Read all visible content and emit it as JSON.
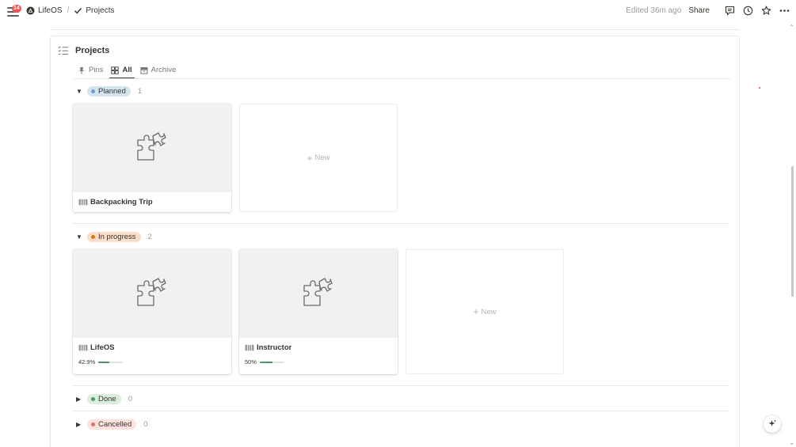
{
  "topbar": {
    "notification_count": "14",
    "breadcrumbs": [
      {
        "label": "LifeOS",
        "icon": "lifeos-logo-icon"
      },
      {
        "label": "Projects",
        "icon": "checkmark-icon"
      }
    ],
    "separator": "/",
    "edited": "Edited 36m ago",
    "share_label": "Share",
    "icons": [
      "comment-icon",
      "clock-icon",
      "star-icon",
      "more-icon"
    ]
  },
  "database": {
    "title": "Projects",
    "tabs": [
      {
        "label": "Pins",
        "icon": "pin-icon",
        "active": false
      },
      {
        "label": "All",
        "icon": "gallery-icon",
        "active": true
      },
      {
        "label": "Archive",
        "icon": "archive-icon",
        "active": false
      }
    ],
    "groups": [
      {
        "name": "Planned",
        "count": "1",
        "expanded": true,
        "color": "#d3e5ef",
        "dot": "#6a9fc9",
        "cards": [
          {
            "title": "Backpacking Trip",
            "icon": "map-icon"
          }
        ],
        "new_label": "New"
      },
      {
        "name": "In progress",
        "count": "2",
        "expanded": true,
        "color": "#fadec9",
        "dot": "#d9730d",
        "cards": [
          {
            "title": "LifeOS",
            "icon": "map-icon",
            "progress_label": "42.9%",
            "progress": 0.429
          },
          {
            "title": "Instructor",
            "icon": "map-icon",
            "progress_label": "50%",
            "progress": 0.5
          }
        ],
        "new_label": "New"
      },
      {
        "name": "Done",
        "count": "0",
        "expanded": false,
        "color": "#dbeddb",
        "dot": "#4f9768"
      },
      {
        "name": "Cancelled",
        "count": "0",
        "expanded": false,
        "color": "#ffe2dd",
        "dot": "#e16f64"
      }
    ]
  },
  "colors": {
    "progress_fill": "#4f9768",
    "notification": "#eb5757"
  }
}
